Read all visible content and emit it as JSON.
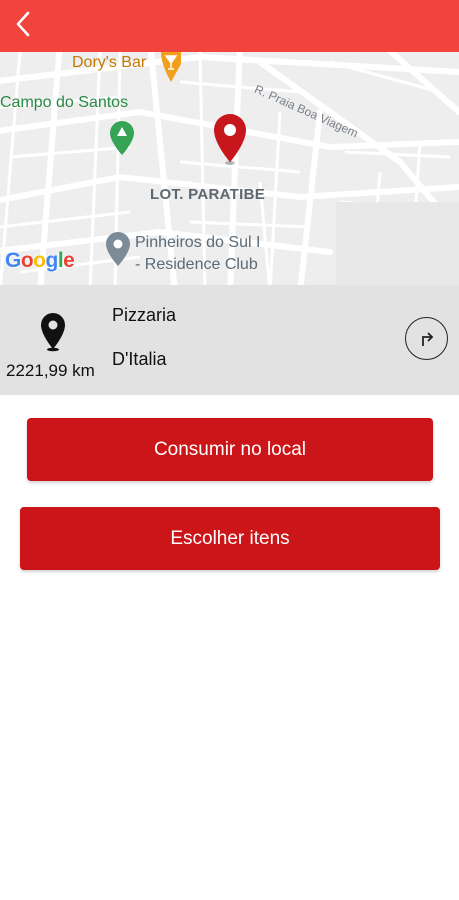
{
  "header": {
    "back_icon": "chevron-left-icon",
    "bg_color": "#f1443d"
  },
  "map": {
    "labels": {
      "dorys_bar": "Dory's Bar",
      "campo_do_santos": "Campo do Santos",
      "lot_paratibe": "LOT. PARATIBE",
      "pinheiros_line1": "Pinheiros do Sul I",
      "pinheiros_line2": "- Residence Club",
      "street": "R. Praia Boa Viagem"
    },
    "provider_logo": "Google",
    "marker_color": "#c8161d"
  },
  "place": {
    "distance": "2221,99 km",
    "name_line1": "Pizzaria",
    "name_line2": "D'Italia",
    "pin_icon": "location-pin-icon",
    "directions_icon": "turn-right-arrow-icon"
  },
  "actions": {
    "consumir_label": "Consumir no local",
    "escolher_label": "Escolher itens",
    "button_color": "#cb1518"
  }
}
